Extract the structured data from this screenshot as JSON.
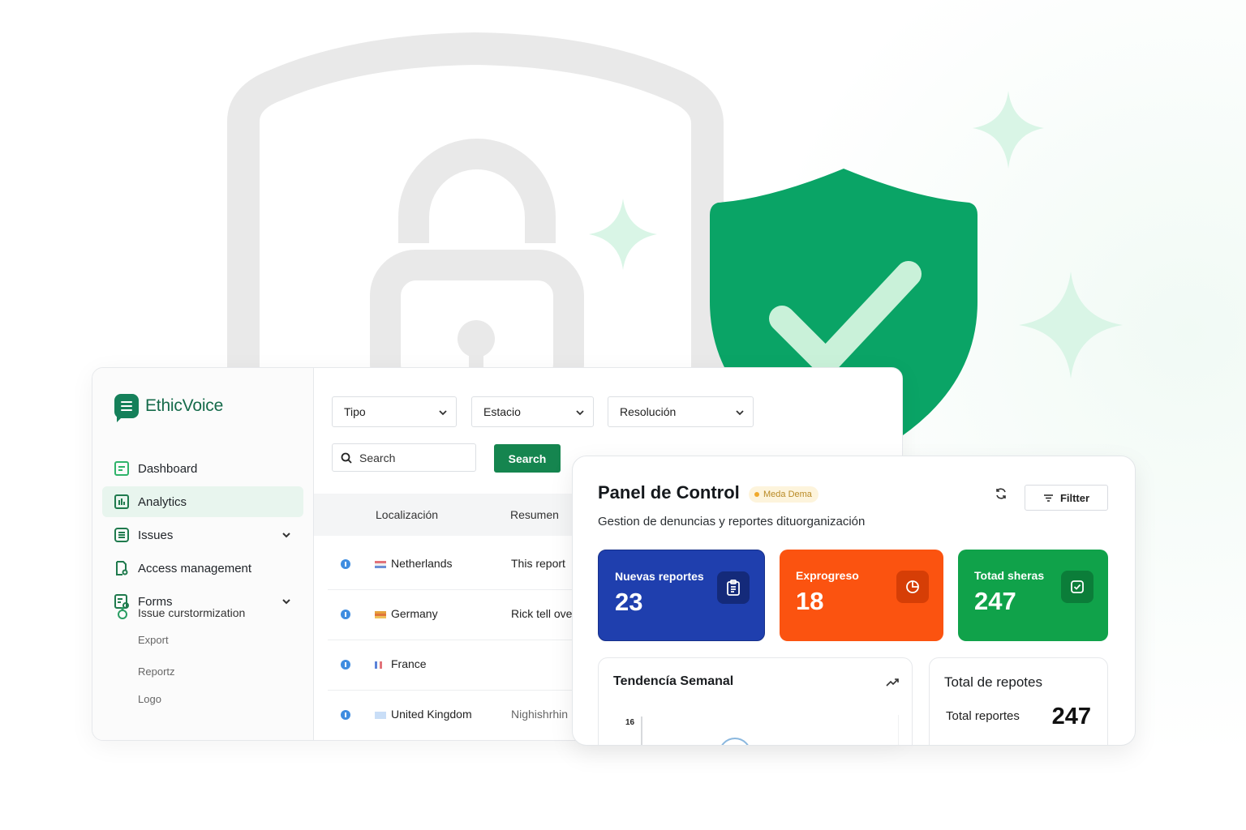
{
  "app": {
    "brand": "EthicVoice"
  },
  "sidebar": {
    "items": [
      {
        "label": "Dashboard",
        "icon": "dashboard-icon"
      },
      {
        "label": "Analytics",
        "icon": "analytics-icon",
        "active": true
      },
      {
        "label": "Issues",
        "icon": "issues-icon",
        "expandable": true
      },
      {
        "label": "Access management",
        "icon": "access-icon"
      },
      {
        "label": "Forms",
        "icon": "forms-icon",
        "expandable": true
      }
    ],
    "sub_items": [
      "Issue curstormization",
      "Export",
      "Reportz",
      "Logo"
    ]
  },
  "filters": {
    "tipo": "Tipo",
    "estado": "Estacio",
    "resolucion": "Resolución",
    "search_placeholder": "Search",
    "search_button": "Search"
  },
  "table": {
    "columns": [
      "Localización",
      "Resumen"
    ],
    "rows": [
      {
        "country": "Netherlands",
        "summary": "This report"
      },
      {
        "country": "Germany",
        "summary": "Rick tell ove"
      },
      {
        "country": "France",
        "summary": ""
      },
      {
        "country": "United Kingdom",
        "summary": "Nighishrhin"
      }
    ]
  },
  "panel": {
    "title": "Panel de Control",
    "badge": "Meda Dema",
    "filter_button": "Filtter",
    "subtitle": "Gestion de denuncias y reportes dituorganización",
    "stats": [
      {
        "label": "Nuevas reportes",
        "value": "23",
        "color": "#1f3fae",
        "icon": "clipboard-icon"
      },
      {
        "label": "Exprogreso",
        "value": "18",
        "color": "#fb5310",
        "icon": "progress-icon"
      },
      {
        "label": "Totad sheras",
        "value": "247",
        "color": "#10a24a",
        "icon": "check-square-icon"
      }
    ],
    "weekly": {
      "title": "Tendencía Semanal",
      "tick": "16"
    },
    "total": {
      "title": "Total de repotes",
      "label": "Total reportes",
      "value": "247"
    }
  },
  "colors": {
    "brand": "#15805a",
    "accent_green": "#0aa466",
    "shield_check": "#c9f1d9"
  }
}
